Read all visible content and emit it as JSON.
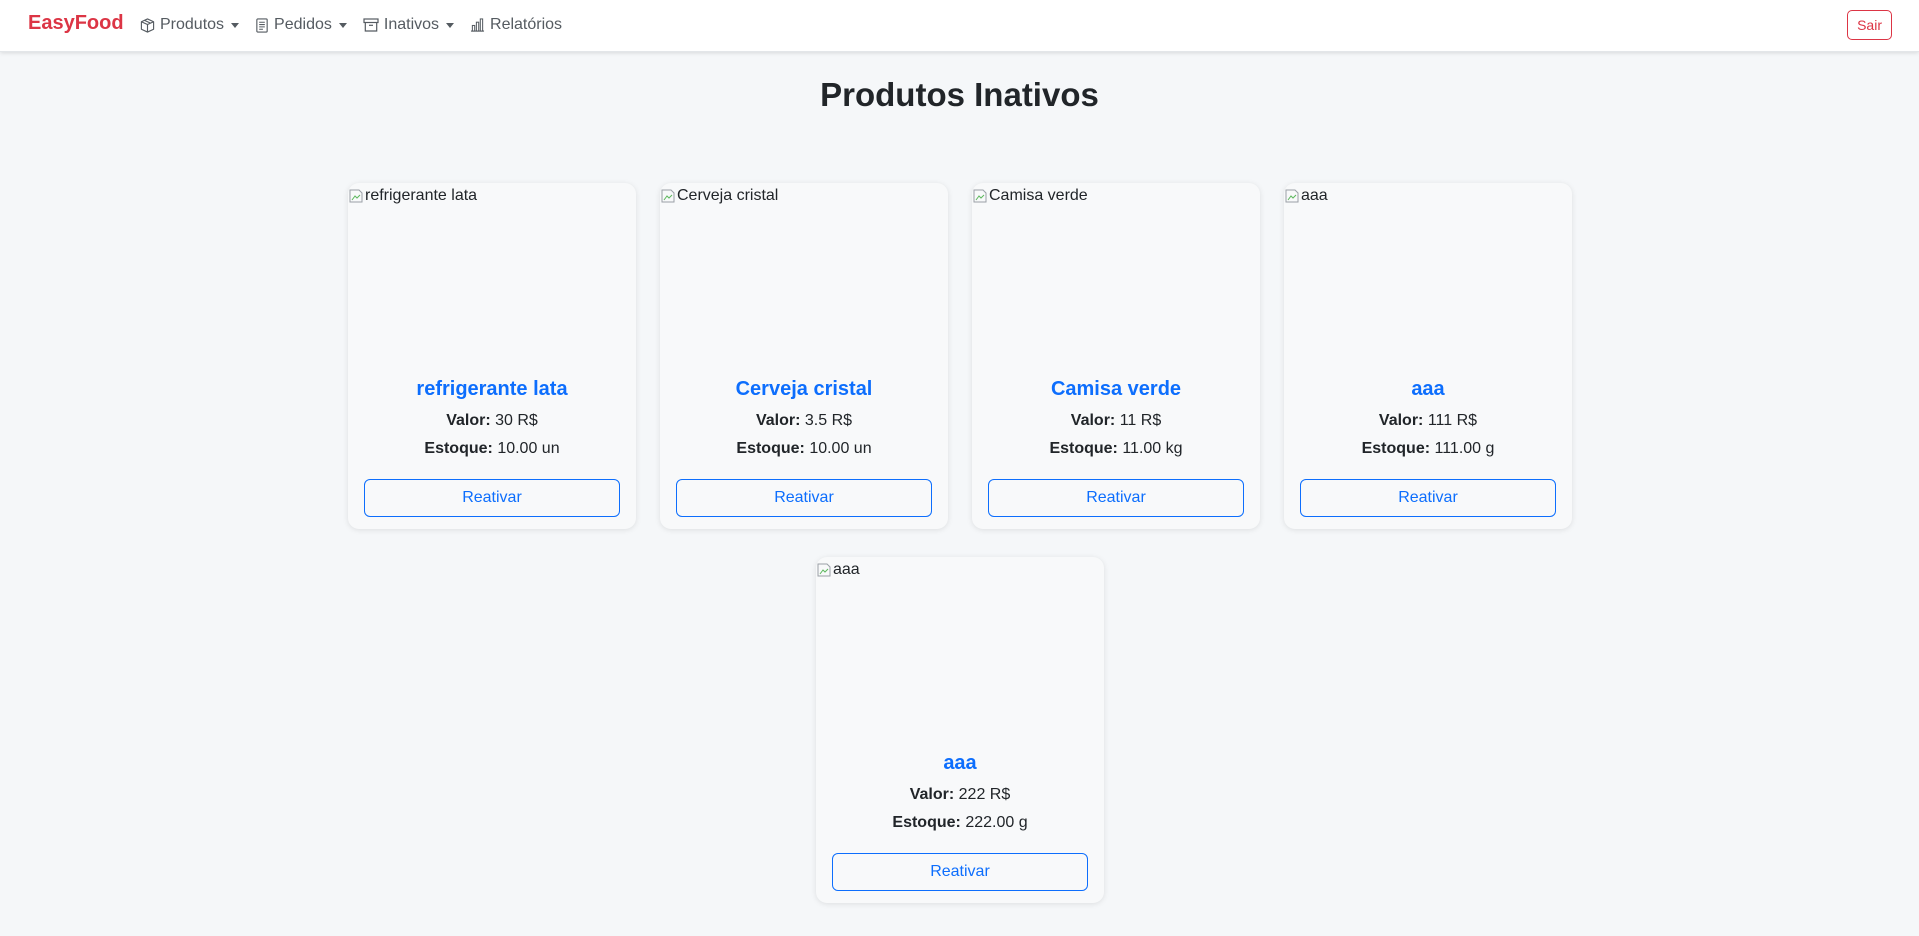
{
  "navbar": {
    "brand": "EasyFood",
    "items": [
      {
        "label": "Produtos",
        "icon": "box-icon",
        "dropdown": true
      },
      {
        "label": "Pedidos",
        "icon": "receipt-icon",
        "dropdown": true
      },
      {
        "label": "Inativos",
        "icon": "archive-icon",
        "dropdown": true
      },
      {
        "label": "Relatórios",
        "icon": "bar-chart-icon",
        "dropdown": false
      }
    ],
    "logout_label": "Sair"
  },
  "page": {
    "title": "Produtos Inativos"
  },
  "labels": {
    "valor": "Valor:",
    "estoque": "Estoque:",
    "reactivate": "Reativar"
  },
  "products": [
    {
      "name": "refrigerante lata",
      "image_alt": "refrigerante lata",
      "valor": "30 R$",
      "estoque": "10.00 un"
    },
    {
      "name": "Cerveja cristal",
      "image_alt": "Cerveja cristal",
      "valor": "3.5 R$",
      "estoque": "10.00 un"
    },
    {
      "name": "Camisa verde",
      "image_alt": "Camisa verde",
      "valor": "11 R$",
      "estoque": "11.00 kg"
    },
    {
      "name": "aaa",
      "image_alt": "aaa",
      "valor": "111 R$",
      "estoque": "111.00 g"
    },
    {
      "name": "aaa",
      "image_alt": "aaa",
      "valor": "222 R$",
      "estoque": "222.00 g"
    }
  ],
  "colors": {
    "brand": "#dc3545",
    "primary": "#0d6efd",
    "background": "#f5f7f9",
    "card": "#f8f9fa"
  }
}
